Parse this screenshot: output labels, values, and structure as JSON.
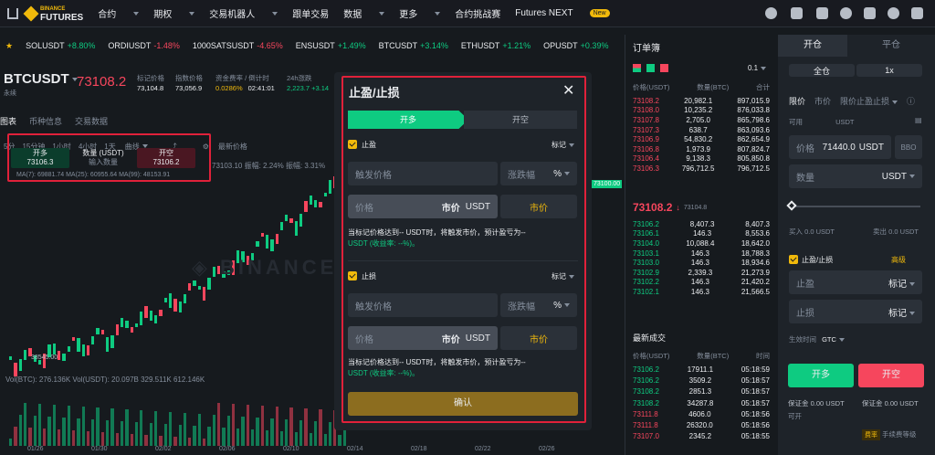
{
  "nav": {
    "logo_top": "BINANCE",
    "logo_bottom": "FUTURES",
    "items": [
      {
        "label": "合约",
        "dropdown": true
      },
      {
        "label": "期权",
        "dropdown": true
      },
      {
        "label": "交易机器人",
        "dropdown": true
      },
      {
        "label": "跟单交易",
        "dropdown": false
      },
      {
        "label": "数据",
        "dropdown": true
      },
      {
        "label": "更多",
        "dropdown": true
      },
      {
        "label": "合约挑战赛",
        "dropdown": false
      },
      {
        "label": "Futures NEXT",
        "dropdown": false
      }
    ],
    "new_badge": "New"
  },
  "tickers": [
    {
      "sym": "SOLUSDT",
      "chg": "+8.80%",
      "up": true
    },
    {
      "sym": "ORDIUSDT",
      "chg": "-1.48%",
      "up": false
    },
    {
      "sym": "1000SATSUSDT",
      "chg": "-4.65%",
      "up": false
    },
    {
      "sym": "ENSUSDT",
      "chg": "+1.49%",
      "up": true
    },
    {
      "sym": "BTCUSDT",
      "chg": "+3.14%",
      "up": true
    },
    {
      "sym": "ETHUSDT",
      "chg": "+1.21%",
      "up": true
    },
    {
      "sym": "OPUSDT",
      "chg": "+0.39%",
      "up": true
    }
  ],
  "symbol": {
    "name": "BTCUSDT",
    "sub": "永续",
    "price": "73108.2",
    "stats": [
      {
        "label": "标记价格",
        "value": "73,104.8"
      },
      {
        "label": "指数价格",
        "value": "73,056.9"
      },
      {
        "label": "资金费率 / 倒计时",
        "value": "0.0286%",
        "value2": "02:41:01"
      },
      {
        "label": "24h涨跌",
        "value": "2,223.7 +3.14"
      }
    ]
  },
  "chart_tabs": [
    "图表",
    "币种信息",
    "交易数据"
  ],
  "chart_toolbar": {
    "intervals": [
      "5分",
      "15分钟",
      "1小时",
      "4小时",
      "1天"
    ],
    "line_label": "曲线",
    "latest_label": "最新价格",
    "info": "73103.10  振幅: 2.24%  振幅: 3.31%"
  },
  "quick_order": {
    "buy_label": "开多",
    "buy_price": "73106.3",
    "qty_label": "数量 (USDT)",
    "qty_placeholder": "输入数量",
    "sell_label": "开空",
    "sell_price": "73106.2"
  },
  "ma_line": "MA(7): 69881.74  MA(25): 60955.64  MA(99): 48153.91",
  "chart_labels": {
    "low_price": "38545.00",
    "right_price": "73100.00",
    "volume": "Vol(BTC): 276.136K  Vol(USDT): 20.097B  329.511K  612.146K"
  },
  "chart_x_labels": [
    "01/26",
    "01/30",
    "02/02",
    "02/06",
    "02/10",
    "02/14",
    "02/18",
    "02/22",
    "02/26"
  ],
  "orderbook": {
    "title": "订单簿",
    "tick": "0.1",
    "headers": [
      "价格(USDT)",
      "数量(BTC)",
      "合计"
    ],
    "asks": [
      [
        "73108.2",
        "20,982.1",
        "897,015.9"
      ],
      [
        "73108.0",
        "10,235.2",
        "876,033.8"
      ],
      [
        "73107.8",
        "2,705.0",
        "865,798.6"
      ],
      [
        "73107.3",
        "638.7",
        "863,093.6"
      ],
      [
        "73106.9",
        "54,830.2",
        "862,654.9"
      ],
      [
        "73106.8",
        "1,973.9",
        "807,824.7"
      ],
      [
        "73106.4",
        "9,138.3",
        "805,850.8"
      ],
      [
        "73106.3",
        "796,712.5",
        "796,712.5"
      ]
    ],
    "last_price": "73108.2",
    "mark_price": "73104.8",
    "bids": [
      [
        "73106.2",
        "8,407.3",
        "8,407.3"
      ],
      [
        "73106.1",
        "146.3",
        "8,553.6"
      ],
      [
        "73104.0",
        "10,088.4",
        "18,642.0"
      ],
      [
        "73103.1",
        "146.3",
        "18,788.3"
      ],
      [
        "73103.0",
        "146.3",
        "18,934.6"
      ],
      [
        "73102.9",
        "2,339.3",
        "21,273.9"
      ],
      [
        "73102.2",
        "146.3",
        "21,420.2"
      ],
      [
        "73102.1",
        "146.3",
        "21,566.5"
      ]
    ]
  },
  "trades": {
    "title": "最新成交",
    "headers": [
      "价格(USDT)",
      "数量(BTC)",
      "时间"
    ],
    "rows": [
      [
        "73106.2",
        "17911.1",
        "05:18:59",
        true
      ],
      [
        "73106.2",
        "3509.2",
        "05:18:57",
        true
      ],
      [
        "73108.2",
        "2851.3",
        "05:18:57",
        true
      ],
      [
        "73108.2",
        "34287.8",
        "05:18:57",
        true
      ],
      [
        "73111.8",
        "4606.0",
        "05:18:56",
        false
      ],
      [
        "73111.8",
        "26320.0",
        "05:18:56",
        false
      ],
      [
        "73107.0",
        "2345.2",
        "05:18:55",
        false
      ]
    ]
  },
  "order_panel": {
    "tabs": [
      "开仓",
      "平仓"
    ],
    "margin_mode": "全仓",
    "leverage": "1x",
    "types": [
      "限价",
      "市价",
      "限价止盈止损"
    ],
    "available_label": "可用",
    "available_value": "USDT",
    "price_label": "价格",
    "price_value": "71440.0",
    "price_unit": "USDT",
    "bbo": "BBO",
    "qty_label": "数量",
    "qty_unit": "USDT",
    "buy_amt": "买入 0.0 USDT",
    "sell_amt": "卖出 0.0 USDT",
    "tpsl_label": "止盈/止损",
    "advanced_label": "高级",
    "tp_placeholder": "止盈",
    "sl_placeholder": "止损",
    "mark_label": "标记",
    "tif_label": "生效时间",
    "tif_value": "GTC",
    "buy_btn": "开多",
    "sell_btn": "开空",
    "margin_buy": "保证金 0.00 USDT",
    "margin_sell": "保证金 0.00 USDT",
    "max_buy": "可开",
    "fee_badge": "费率",
    "fee_label": "手续费等级"
  },
  "modal": {
    "title": "止盈/止损",
    "tab_long": "开多",
    "tab_short": "开空",
    "tp_label": "止盈",
    "sl_label": "止损",
    "mark_label": "标记",
    "trigger_placeholder": "触发价格",
    "pct_placeholder": "涨跌幅",
    "pct_unit": "%",
    "price_placeholder": "价格",
    "market_inline": "市价",
    "usdt_unit": "USDT",
    "market_btn": "市价",
    "tp_desc_1": "当标记价格达到-- USDT时，将触发市价，预计盈亏为--",
    "tp_desc_2": "USDT (收益率: --%)。",
    "sl_desc_1": "当标记价格达到-- USDT时，将触发市价，预计盈亏为--",
    "sl_desc_2": "USDT (收益率: --%)。",
    "confirm": "确认"
  },
  "colors": {
    "up": "#0ecb81",
    "down": "#f6465d",
    "accent": "#f0b90b",
    "highlight": "#e0213a"
  }
}
